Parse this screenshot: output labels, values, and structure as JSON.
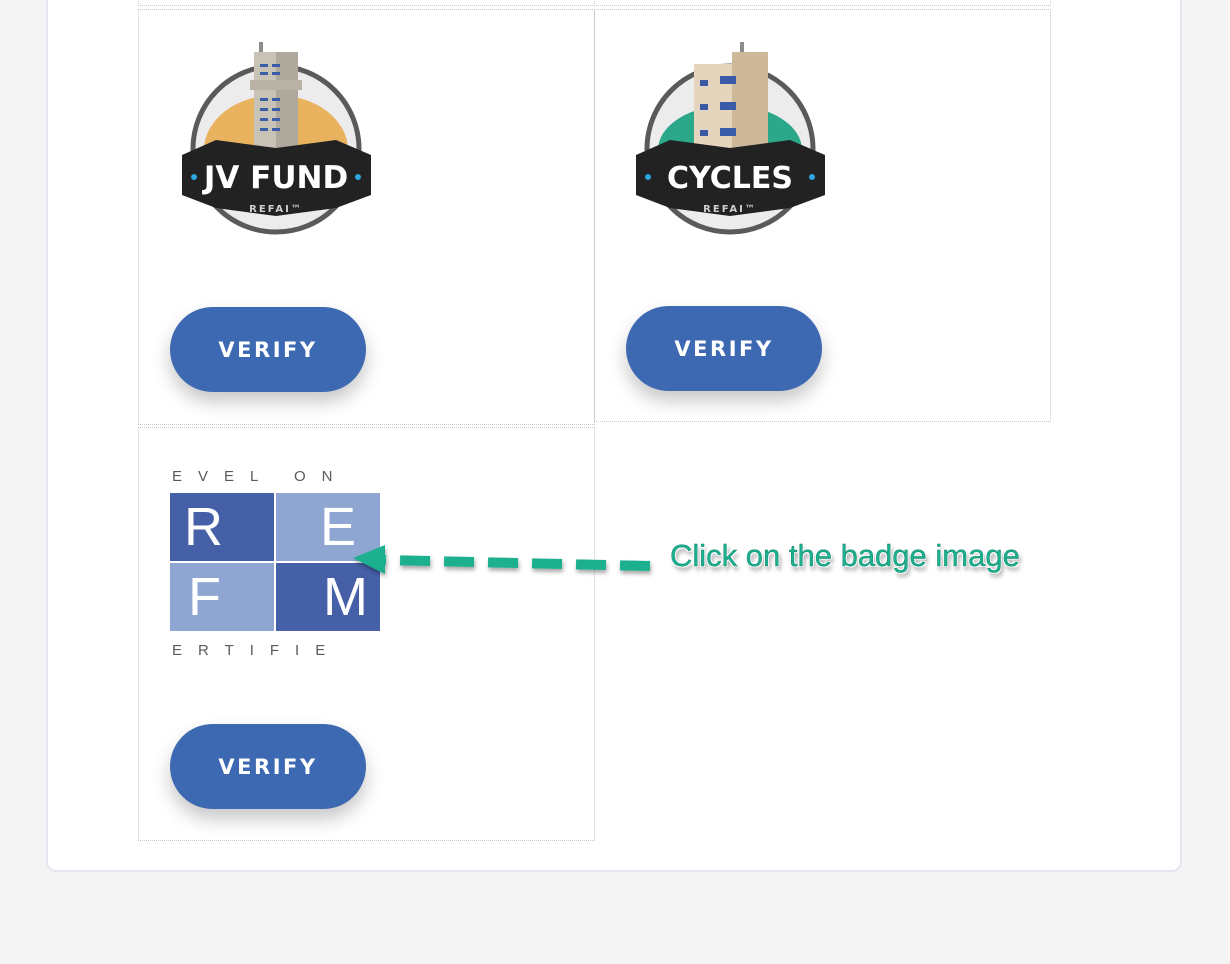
{
  "badges": [
    {
      "id": "jv-fund",
      "title": "JV FUND",
      "subtitle": "REFAI™",
      "accent_color": "#e9b25e",
      "verify_label": "VERIFY"
    },
    {
      "id": "cycles",
      "title": "CYCLES",
      "subtitle": "REFAI™",
      "accent_color": "#2aa889",
      "verify_label": "VERIFY"
    },
    {
      "id": "refm",
      "top_text": "EVEL ON",
      "letters": [
        "R",
        "E",
        "F",
        "M"
      ],
      "bottom_text": "ERTIFIE",
      "verify_label": "VERIFY"
    }
  ],
  "annotation": {
    "text": "Click on the badge image",
    "color": "#1db08e"
  },
  "colors": {
    "button": "#3d68b2",
    "refm_dark": "#4660a8",
    "refm_light": "#8fa6d3",
    "badge_band": "#222222"
  }
}
